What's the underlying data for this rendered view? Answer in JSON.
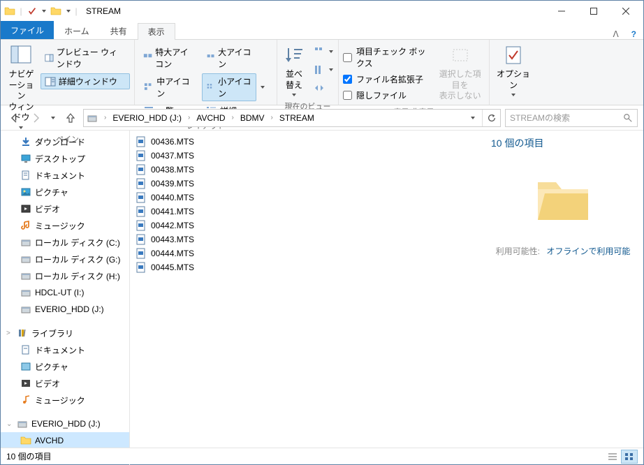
{
  "window": {
    "title": "STREAM"
  },
  "tabs": {
    "file": "ファイル",
    "home": "ホーム",
    "share": "共有",
    "view": "表示"
  },
  "ribbon": {
    "panes": {
      "navigation": "ナビゲーション\nウィンドウ",
      "preview": "プレビュー ウィンドウ",
      "details": "詳細ウィンドウ",
      "group_label": "ペイン"
    },
    "layout": {
      "extra_large": "特大アイコン",
      "large": "大アイコン",
      "medium": "中アイコン",
      "small": "小アイコン",
      "list": "一覧",
      "details": "詳細",
      "group_label": "レイアウト"
    },
    "current_view": {
      "sort": "並べ替え",
      "group_label": "現在のビュー"
    },
    "show_hide": {
      "item_checkboxes": "項目チェック ボックス",
      "file_ext": "ファイル名拡張子",
      "hidden": "隠しファイル",
      "hide_selected": "選択した項目を\n表示しない",
      "group_label": "表示/非表示"
    },
    "options": {
      "label": "オプション"
    }
  },
  "breadcrumbs": [
    "EVERIO_HDD (J:)",
    "AVCHD",
    "BDMV",
    "STREAM"
  ],
  "search": {
    "placeholder": "STREAMの検索"
  },
  "nav_items": [
    {
      "label": "ダウンロード",
      "icon": "download",
      "indent": 1
    },
    {
      "label": "デスクトップ",
      "icon": "desktop",
      "indent": 1
    },
    {
      "label": "ドキュメント",
      "icon": "document",
      "indent": 1
    },
    {
      "label": "ピクチャ",
      "icon": "pictures",
      "indent": 1
    },
    {
      "label": "ビデオ",
      "icon": "videos",
      "indent": 1
    },
    {
      "label": "ミュージック",
      "icon": "music",
      "indent": 1
    },
    {
      "label": "ローカル ディスク (C:)",
      "icon": "drive",
      "indent": 1
    },
    {
      "label": "ローカル ディスク (G:)",
      "icon": "drive",
      "indent": 1
    },
    {
      "label": "ローカル ディスク (H:)",
      "icon": "drive",
      "indent": 1
    },
    {
      "label": "HDCL-UT (I:)",
      "icon": "drive",
      "indent": 1
    },
    {
      "label": "EVERIO_HDD (J:)",
      "icon": "drive",
      "indent": 1
    },
    {
      "label": "",
      "icon": "",
      "indent": 0,
      "spacer": true
    },
    {
      "label": "ライブラリ",
      "icon": "libraries",
      "indent": 0,
      "expander": ">"
    },
    {
      "label": "ドキュメント",
      "icon": "doc-lib",
      "indent": 1
    },
    {
      "label": "ピクチャ",
      "icon": "pic-lib",
      "indent": 1
    },
    {
      "label": "ビデオ",
      "icon": "vid-lib",
      "indent": 1
    },
    {
      "label": "ミュージック",
      "icon": "mus-lib",
      "indent": 1
    },
    {
      "label": "",
      "icon": "",
      "indent": 0,
      "spacer": true
    },
    {
      "label": "EVERIO_HDD (J:)",
      "icon": "drive",
      "indent": 0,
      "expander": "⌄"
    },
    {
      "label": "AVCHD",
      "icon": "folder",
      "indent": 1,
      "selected": true
    }
  ],
  "files": [
    "00436.MTS",
    "00437.MTS",
    "00438.MTS",
    "00439.MTS",
    "00440.MTS",
    "00441.MTS",
    "00442.MTS",
    "00443.MTS",
    "00444.MTS",
    "00445.MTS"
  ],
  "details_pane": {
    "title": "10 個の項目",
    "availability_k": "利用可能性:",
    "availability_v": "オフラインで利用可能"
  },
  "status": {
    "text": "10 個の項目"
  }
}
